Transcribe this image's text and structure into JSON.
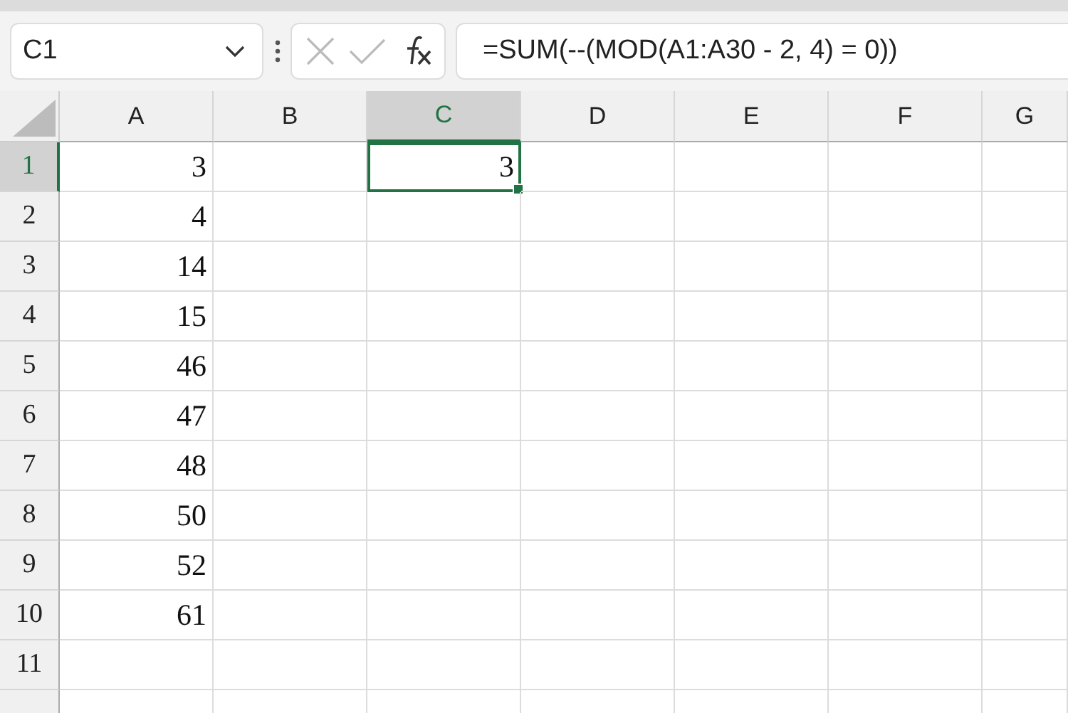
{
  "name_box": {
    "value": "C1"
  },
  "formula_bar": {
    "value": "=SUM(--(MOD(A1:A30 - 2, 4) = 0))"
  },
  "columns": [
    {
      "label": "A",
      "selected": false
    },
    {
      "label": "B",
      "selected": false
    },
    {
      "label": "C",
      "selected": true
    },
    {
      "label": "D",
      "selected": false
    },
    {
      "label": "E",
      "selected": false
    },
    {
      "label": "F",
      "selected": false
    },
    {
      "label": "G",
      "selected": false
    }
  ],
  "rows": [
    {
      "label": "1",
      "selected": true,
      "cells": [
        "3",
        null,
        "3"
      ]
    },
    {
      "label": "2",
      "selected": false,
      "cells": [
        "4"
      ]
    },
    {
      "label": "3",
      "selected": false,
      "cells": [
        "14"
      ]
    },
    {
      "label": "4",
      "selected": false,
      "cells": [
        "15"
      ]
    },
    {
      "label": "5",
      "selected": false,
      "cells": [
        "46"
      ]
    },
    {
      "label": "6",
      "selected": false,
      "cells": [
        "47"
      ]
    },
    {
      "label": "7",
      "selected": false,
      "cells": [
        "48"
      ]
    },
    {
      "label": "8",
      "selected": false,
      "cells": [
        "50"
      ]
    },
    {
      "label": "9",
      "selected": false,
      "cells": [
        "52"
      ]
    },
    {
      "label": "10",
      "selected": false,
      "cells": [
        "61"
      ]
    },
    {
      "label": "11",
      "selected": false,
      "cells": []
    }
  ]
}
